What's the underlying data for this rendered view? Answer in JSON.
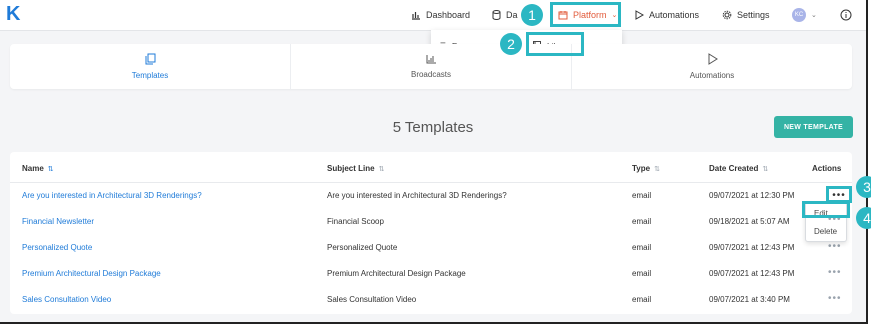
{
  "logo": "K",
  "nav": {
    "dashboard": "Dashboard",
    "data": "Da",
    "platform": "Platform",
    "automations": "Automations",
    "settings": "Settings",
    "avatar": "KC"
  },
  "platform_menu": {
    "forms": "Forms",
    "library": "Library"
  },
  "tabs": [
    {
      "label": "Templates",
      "active": true
    },
    {
      "label": "Broadcasts",
      "active": false
    },
    {
      "label": "Automations",
      "active": false
    }
  ],
  "templates_count_label": "5 Templates",
  "new_template_label": "NEW TEMPLATE",
  "table": {
    "headers": {
      "name": "Name",
      "subject": "Subject Line",
      "type": "Type",
      "date": "Date Created",
      "actions": "Actions"
    },
    "rows": [
      {
        "name": "Are you interested in Architectural 3D Renderings?",
        "subject": "Are you interested in Architectural 3D Renderings?",
        "type": "email",
        "date": "09/07/2021 at 12:30 PM",
        "actions": "•••"
      },
      {
        "name": "Financial Newsletter",
        "subject": "Financial Scoop",
        "type": "email",
        "date": "09/18/2021 at 5:07 AM",
        "actions": "•••"
      },
      {
        "name": "Personalized Quote",
        "subject": "Personalized Quote",
        "type": "email",
        "date": "09/07/2021 at 12:43 PM",
        "actions": "•••"
      },
      {
        "name": "Premium Architectural Design Package",
        "subject": "Premium Architectural Design Package",
        "type": "email",
        "date": "09/07/2021 at 12:43 PM",
        "actions": "•••"
      },
      {
        "name": "Sales Consultation Video",
        "subject": "Sales Consultation Video",
        "type": "email",
        "date": "09/07/2021 at 3:40 PM",
        "actions": "•••"
      }
    ]
  },
  "row_menu": {
    "edit": "Edit",
    "delete": "Delete"
  },
  "step_badges": [
    "1",
    "2",
    "3",
    "4"
  ],
  "colors": {
    "accent_blue": "#1f7bd8",
    "platform_orange": "#e25b3b",
    "new_button_teal": "#34b3a5",
    "annotation_teal": "#2bb7c3"
  }
}
